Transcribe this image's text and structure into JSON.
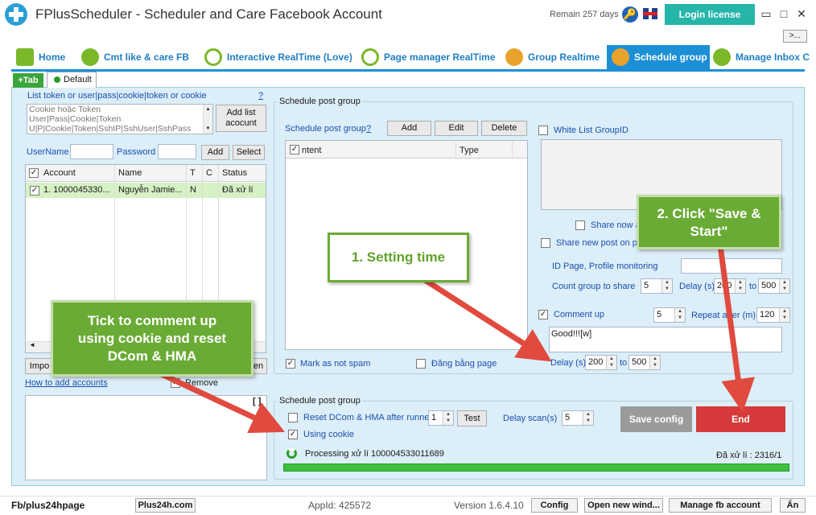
{
  "window": {
    "title": "FPlusScheduler - Scheduler and Care Facebook Account",
    "remain": "Remain 257 days",
    "login_label": "Login license",
    "minimize": "□",
    "maximize": "▫",
    "close": "✕",
    "expand_label": ">..."
  },
  "tabs": [
    {
      "label": "Home",
      "icon": "home-icon"
    },
    {
      "label": "Cmt like & care FB",
      "icon": "people-icon"
    },
    {
      "label": "Interactive RealTime (Love)",
      "icon": "clock-icon"
    },
    {
      "label": "Page manager RealTime",
      "icon": "clock-icon"
    },
    {
      "label": "Group Realtime",
      "icon": "group-icon"
    },
    {
      "label": "Schedule group",
      "icon": "group-icon"
    },
    {
      "label": "Manage Inbox C",
      "icon": "chat-icon"
    }
  ],
  "subtabs": {
    "add": "+Tab",
    "default": "Default"
  },
  "left": {
    "token_label": "List token or user|pass|cookie|token or cookie",
    "help": "?",
    "token_placeholder": "Cookie hoặc Token\nUser|Pass|Cookie|Token\nU|P|Cookie|Token|SshIP|SshUser|SshPass",
    "add_list_label": "Add list\nacocunt",
    "username_label": "UserName",
    "password_label": "Password",
    "add_label": "Add",
    "select_label": "Select",
    "columns": [
      "Account",
      "Name",
      "T",
      "C",
      "Status"
    ],
    "rows": [
      {
        "account": "1. 1000045330...",
        "name": "Nguyễn Jamie...",
        "t": "N",
        "c": "",
        "status": "Đã xử lí"
      }
    ],
    "import_label": "Impo",
    "import_right_label": "en",
    "how_to": "How to add accounts",
    "remove_label": "Remove",
    "log_btn": "[ ]"
  },
  "schedule": {
    "group_title": "Schedule post group",
    "inner_label": "Schedule post group",
    "help": "?",
    "add": "Add",
    "edit": "Edit",
    "delete": "Delete",
    "list_columns": [
      "ntent",
      "Type"
    ],
    "mark_spam": "Mark as not spam",
    "dang_bang_page": "Đăng bằng page",
    "whitelist": "White List GroupID",
    "share_now": "Share now a",
    "share_new_post": "Share new post on p",
    "id_page": "ID Page, Profile monitoring",
    "count_group": "Count group to share",
    "count_group_val": "5",
    "delay_label": "Delay (s)",
    "delay_from": "200",
    "delay_to_label": "to",
    "delay_to": "500",
    "comment_up": "Comment up",
    "comment_up_val": "5",
    "repeat_after": "Repeat after (m)",
    "repeat_val": "120",
    "comment_text": "Good!!![w]",
    "delay2_label": "Delay (s)",
    "delay2_from": "200",
    "delay2_to_label": "to",
    "delay2_to": "500"
  },
  "bottom": {
    "group_title": "Schedule post group",
    "reset_label": "Reset DCom & HMA after runned",
    "reset_val": "1",
    "test_label": "Test",
    "delay_scan_label": "Delay scan(s)",
    "delay_scan_val": "5",
    "using_cookie": "Using cookie",
    "save_config": "Save config",
    "end": "End",
    "processing": "Processing xử lí 100004533011689",
    "processed": "Đã xử lí : 2316/1"
  },
  "callouts": {
    "setting_time": "1. Setting time",
    "save_start": "2. Click \"Save &\nStart\"",
    "tick_comment": "Tick to comment up\nusing cookie and reset\nDCom & HMA"
  },
  "status": {
    "fb": "Fb/plus24hpage",
    "site": "Plus24h.com",
    "appid": "AppId: 425572",
    "version": "Version 1.6.4.10",
    "config": "Config",
    "open_new": "Open new wind...",
    "manage_fb": "Manage fb account",
    "an": "Ẩn"
  },
  "colors": {
    "accent": "#1c8fd6",
    "login": "#25b5a9",
    "end": "#d63a3a",
    "save_config": "#9b9b9b",
    "callout_green": "#6aab35",
    "arrow_red": "#e04a3f",
    "panel_bg": "#dceef8"
  }
}
